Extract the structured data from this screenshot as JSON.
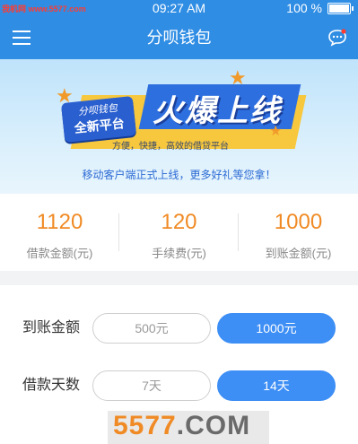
{
  "status": {
    "watermark": "我机网 www.5577.com",
    "time": "09:27 AM",
    "battery": "100 %",
    "battery_level": 1.0
  },
  "nav": {
    "title": "分呗钱包",
    "menu_icon": "hamburger-menu-icon",
    "message_icon": "chat-bubble-icon"
  },
  "banner": {
    "tag_line1": "分呗钱包",
    "tag_line2": "全新平台",
    "headline": "火爆上线",
    "subline": "方便，快捷，高效的借贷平台",
    "bottom": "移动客户端正式上线，更多好礼等您拿！"
  },
  "stats": [
    {
      "value": "1120",
      "label": "借款金额(元)"
    },
    {
      "value": "120",
      "label": "手续费(元)"
    },
    {
      "value": "1000",
      "label": "到账金额(元)"
    }
  ],
  "form": {
    "amount_label": "到账金额",
    "amount_options": [
      "500元",
      "1000元"
    ],
    "days_label": "借款天数",
    "days_options": [
      "7天",
      "14天"
    ]
  },
  "watermark_logo": {
    "main": "5577",
    "suffix": ".COM"
  },
  "colors": {
    "primary": "#2f8de4",
    "accent": "#f08a24",
    "selected": "#3d8ef5"
  }
}
